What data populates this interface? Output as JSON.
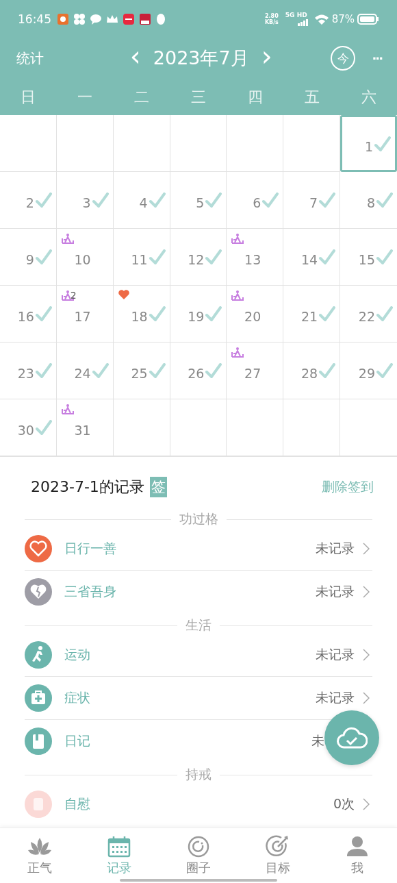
{
  "status_bar": {
    "time": "16:45",
    "speed": "2.80",
    "speed_unit": "KB/s",
    "network": "5G HD",
    "battery": "87%"
  },
  "header": {
    "left": "统计",
    "prev": "‹",
    "month": "2023年7月",
    "next": "›",
    "today": "今",
    "more": "···"
  },
  "weekdays": [
    "日",
    "一",
    "二",
    "三",
    "四",
    "五",
    "六"
  ],
  "calendar": {
    "days": [
      {
        "day": "1",
        "checked": true,
        "selected": true
      },
      {
        "day": "2",
        "checked": true,
        "selected": false
      },
      {
        "day": "3",
        "checked": true,
        "selected": false
      },
      {
        "day": "4",
        "checked": true,
        "selected": false
      },
      {
        "day": "5",
        "checked": true,
        "selected": false
      },
      {
        "day": "6",
        "checked": true,
        "selected": false
      },
      {
        "day": "7",
        "checked": true,
        "selected": false
      },
      {
        "day": "8",
        "checked": true,
        "selected": false
      },
      {
        "day": "9",
        "checked": true,
        "selected": false
      },
      {
        "day": "10",
        "checked": false,
        "selected": false,
        "kind": "meditation"
      },
      {
        "day": "11",
        "checked": true,
        "selected": false
      },
      {
        "day": "12",
        "checked": true,
        "selected": false
      },
      {
        "day": "13",
        "checked": false,
        "selected": false,
        "kind": "meditation"
      },
      {
        "day": "14",
        "checked": true,
        "selected": false
      },
      {
        "day": "15",
        "checked": true,
        "selected": false
      },
      {
        "day": "16",
        "checked": true,
        "selected": false
      },
      {
        "day": "17",
        "checked": false,
        "selected": false,
        "kind": "meditation",
        "count": "2"
      },
      {
        "day": "18",
        "checked": true,
        "selected": false,
        "kind": "heart"
      },
      {
        "day": "19",
        "checked": true,
        "selected": false
      },
      {
        "day": "20",
        "checked": false,
        "selected": false,
        "kind": "meditation"
      },
      {
        "day": "21",
        "checked": true,
        "selected": false
      },
      {
        "day": "22",
        "checked": true,
        "selected": false
      },
      {
        "day": "23",
        "checked": true,
        "selected": false
      },
      {
        "day": "24",
        "checked": true,
        "selected": false
      },
      {
        "day": "25",
        "checked": true,
        "selected": false
      },
      {
        "day": "26",
        "checked": true,
        "selected": false
      },
      {
        "day": "27",
        "checked": false,
        "selected": false,
        "kind": "meditation"
      },
      {
        "day": "28",
        "checked": true,
        "selected": false
      },
      {
        "day": "29",
        "checked": true,
        "selected": false
      },
      {
        "day": "30",
        "checked": true,
        "selected": false
      },
      {
        "day": "31",
        "checked": false,
        "selected": false,
        "kind": "meditation"
      }
    ]
  },
  "record": {
    "title": "2023-7-1的记录",
    "badge": "签",
    "action": "删除签到"
  },
  "sections": [
    {
      "title": "功过格",
      "items": [
        {
          "label": "日行一善",
          "status": "未记录",
          "kind": "heart",
          "color": "#ee6a45",
          "chevron": true
        },
        {
          "label": "三省吾身",
          "status": "未记录",
          "kind": "broken-heart",
          "color": "#9e9da6",
          "chevron": true
        }
      ]
    },
    {
      "title": "生活",
      "items": [
        {
          "label": "运动",
          "status": "未记录",
          "kind": "run",
          "color": "#6bb5ac",
          "chevron": true
        },
        {
          "label": "症状",
          "status": "未记录",
          "kind": "kit",
          "color": "#6bb5ac",
          "chevron": true
        },
        {
          "label": "日记",
          "status": "未",
          "kind": "book",
          "color": "#6bb5ac",
          "chevron": false
        }
      ]
    },
    {
      "title": "持戒",
      "items": [
        {
          "label": "自慰",
          "status": "0次",
          "kind": "roll",
          "color": "#fbd9d6",
          "chevron": true
        }
      ]
    }
  ],
  "nav": [
    {
      "label": "正气",
      "kind": "lotus",
      "selected": false
    },
    {
      "label": "记录",
      "kind": "calendar",
      "selected": true
    },
    {
      "label": "圈子",
      "kind": "ring",
      "selected": false
    },
    {
      "label": "目标",
      "kind": "target",
      "selected": false
    },
    {
      "label": "我",
      "kind": "person",
      "selected": false
    }
  ]
}
